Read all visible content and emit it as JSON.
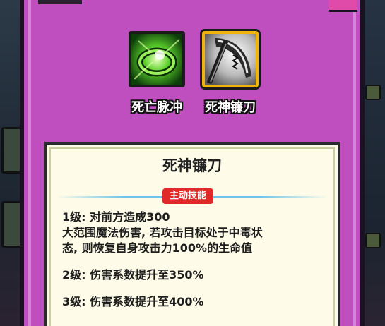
{
  "skills": [
    {
      "label": "死亡脉冲",
      "icon": "green-ring-icon",
      "selected": false
    },
    {
      "label": "死神镰刀",
      "icon": "scythe-icon",
      "selected": true
    }
  ],
  "detail": {
    "title": "死神镰刀",
    "badge": "主动技能",
    "level1_line1": "1级:  对前方造成300",
    "level1_line2": "大范围魔法伤害,  若攻击目标处于中毒状",
    "level1_line3": "态,  则恢复自身攻击力100%的生命值",
    "level2": "2级:  伤害系数提升至350%",
    "level3": "3级:  伤害系数提升至400%"
  },
  "colors": {
    "panel": "#bf4fbf",
    "selected_border": "#f2b30a",
    "badge": "#e02a2a",
    "desc_bg": "#fefce8"
  }
}
